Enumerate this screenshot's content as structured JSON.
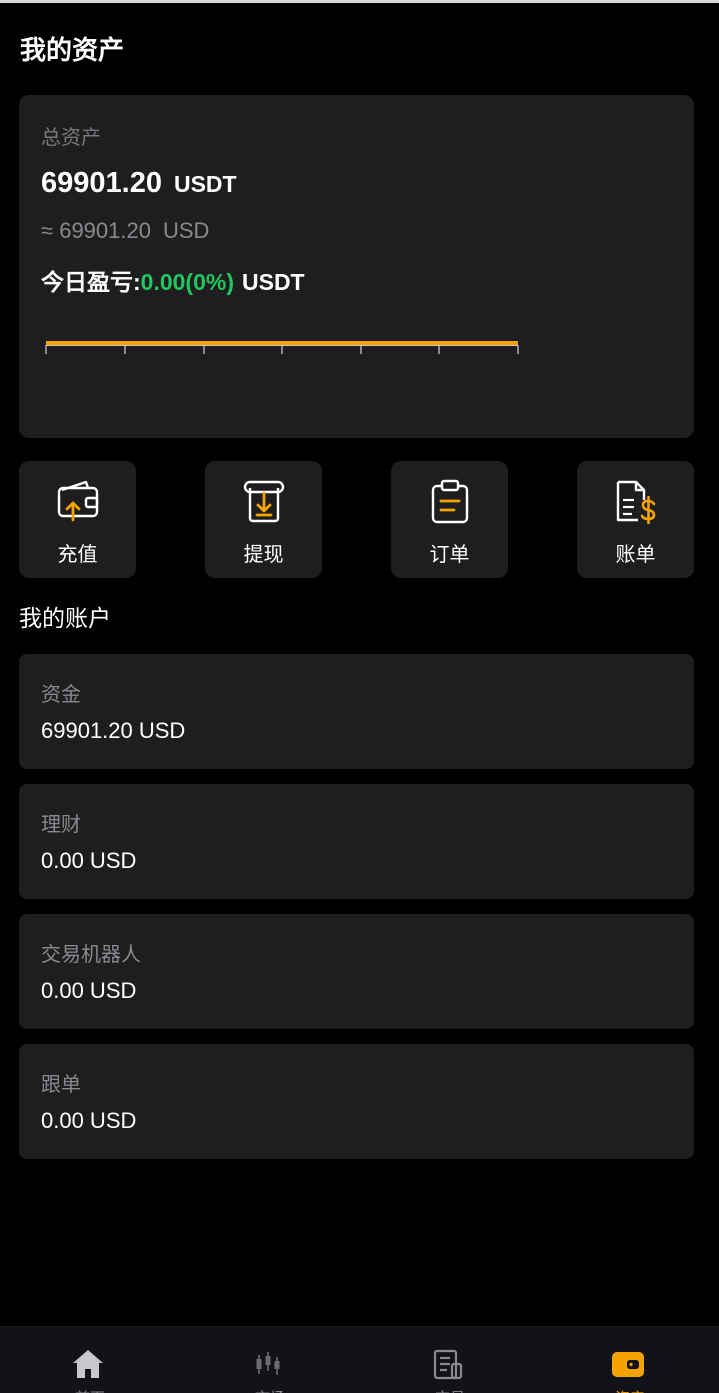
{
  "page": {
    "title": "我的资产"
  },
  "total": {
    "label": "总资产",
    "amount": "69901.20",
    "unit": "USDT",
    "approx_prefix": "≈",
    "approx_amount": "69901.20",
    "approx_unit": "USD",
    "pnl_label": "今日盈亏:",
    "pnl_value": "0.00(0%)",
    "pnl_unit": "USDT"
  },
  "actions": [
    {
      "label": "充值",
      "icon": "wallet-deposit-icon"
    },
    {
      "label": "提现",
      "icon": "withdraw-icon"
    },
    {
      "label": "订单",
      "icon": "clipboard-icon"
    },
    {
      "label": "账单",
      "icon": "bill-dollar-icon"
    }
  ],
  "accounts_title": "我的账户",
  "accounts": [
    {
      "name": "资金",
      "value": "69901.20 USD"
    },
    {
      "name": "理财",
      "value": "0.00 USD"
    },
    {
      "name": "交易机器人",
      "value": "0.00 USD"
    },
    {
      "name": "跟单",
      "value": "0.00 USD"
    }
  ],
  "tabs": [
    {
      "label": "首页",
      "icon": "home-icon",
      "active": false
    },
    {
      "label": "市场",
      "icon": "candlestick-icon",
      "active": false
    },
    {
      "label": "交易",
      "icon": "document-icon",
      "active": false
    },
    {
      "label": "资产",
      "icon": "wallet-icon",
      "active": true
    }
  ],
  "colors": {
    "accent": "#f5a300",
    "positive": "#22c55e",
    "card": "#1e1e20",
    "background": "#000000"
  }
}
